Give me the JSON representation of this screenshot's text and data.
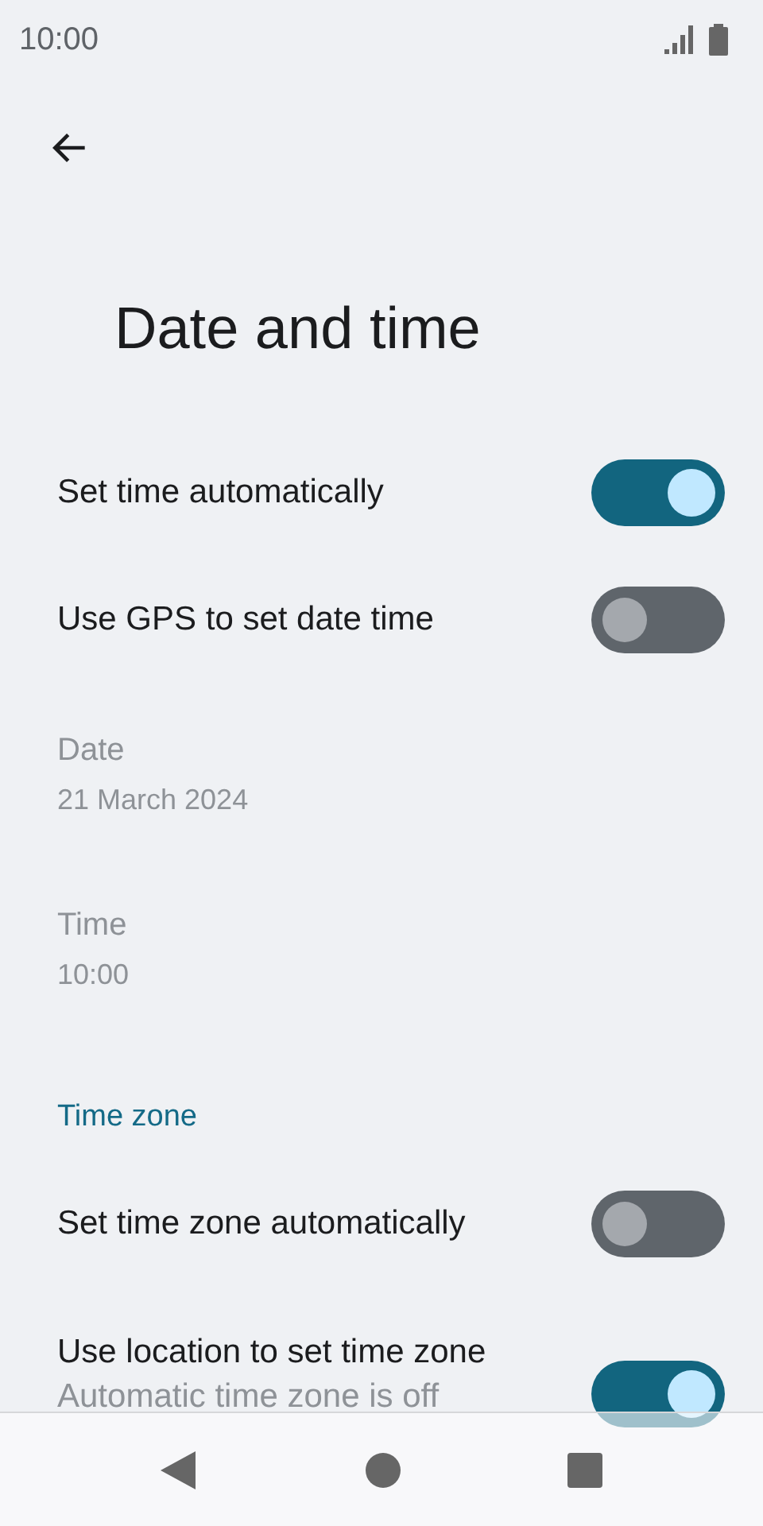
{
  "status_bar": {
    "time": "10:00"
  },
  "title": "Date and time",
  "items": [
    {
      "kind": "toggle",
      "label": "Set time automatically",
      "on": true
    },
    {
      "kind": "toggle",
      "label": "Use GPS to set date time",
      "on": false
    },
    {
      "kind": "info",
      "label": "Date",
      "value": "21 March 2024",
      "disabled": true
    },
    {
      "kind": "info",
      "label": "Time",
      "value": "10:00",
      "disabled": true
    },
    {
      "kind": "header",
      "label": "Time zone"
    },
    {
      "kind": "toggle",
      "label": "Set time zone automatically",
      "on": false
    },
    {
      "kind": "toggle",
      "label": "Use location to set time zone",
      "on": true,
      "subtitle": "Automatic time zone is off",
      "subtitle_disabled": true
    }
  ]
}
